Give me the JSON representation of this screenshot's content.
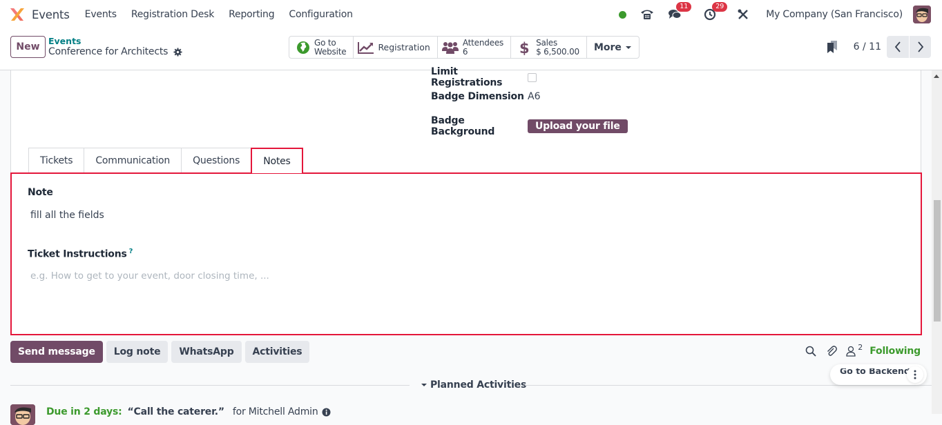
{
  "topbar": {
    "app_name": "Events",
    "menu": [
      "Events",
      "Registration Desk",
      "Reporting",
      "Configuration"
    ],
    "status_color": "#3c9a2d",
    "messages_badge": "11",
    "activities_badge": "29",
    "company": "My Company (San Francisco)"
  },
  "control": {
    "new_label": "New",
    "breadcrumb_parent": "Events",
    "record_title": "Conference for Architects",
    "smart_buttons": {
      "website": {
        "line1": "Go to",
        "line2": "Website"
      },
      "registration": {
        "label": "Registration"
      },
      "attendees": {
        "label": "Attendees",
        "value": "6"
      },
      "sales": {
        "label": "Sales",
        "value": "$ 6,500.00"
      },
      "more": {
        "label": "More"
      }
    },
    "pager": "6 / 11"
  },
  "form": {
    "limit_registrations": {
      "label": "Limit Registrations",
      "checked": false
    },
    "badge_dimension": {
      "label": "Badge Dimension",
      "value": "A6"
    },
    "badge_background": {
      "label": "Badge Background",
      "button": "Upload your file"
    }
  },
  "tabs": [
    {
      "label": "Tickets",
      "active": false
    },
    {
      "label": "Communication",
      "active": false
    },
    {
      "label": "Questions",
      "active": false
    },
    {
      "label": "Notes",
      "active": true
    }
  ],
  "notes": {
    "note_label": "Note",
    "note_value": "fill all the fields",
    "ticket_label": "Ticket Instructions",
    "ticket_help": "?",
    "ticket_placeholder": "e.g. How to get to your event, door closing time, ..."
  },
  "chatter": {
    "send_message": "Send message",
    "log_note": "Log note",
    "whatsapp": "WhatsApp",
    "activities": "Activities",
    "followers_count": "2",
    "following": "Following",
    "planned_activities": "Planned Activities",
    "activity": {
      "due": "Due in 2 days:",
      "title": "“Call the caterer.”",
      "assignee": "for Mitchell Admin"
    }
  },
  "floating": {
    "go_to_backend": "Go to Backend"
  },
  "colors": {
    "brand": "#714b67",
    "highlight": "#e4163a",
    "success": "#3c9a2d",
    "link": "#017e84"
  }
}
